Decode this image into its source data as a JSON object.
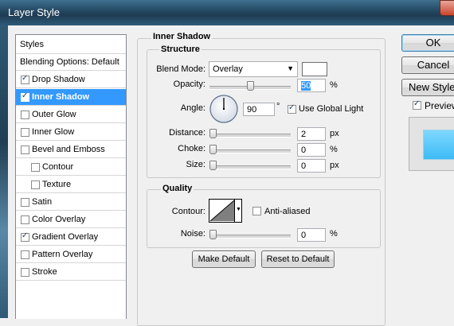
{
  "window": {
    "title": "Layer Style"
  },
  "styles_panel": {
    "header": "Styles",
    "items": [
      {
        "label": "Blending Options: Default",
        "checkbox": false,
        "checked": false,
        "indent": false,
        "selected": false
      },
      {
        "label": "Drop Shadow",
        "checkbox": true,
        "checked": true,
        "indent": false,
        "selected": false
      },
      {
        "label": "Inner Shadow",
        "checkbox": true,
        "checked": true,
        "indent": false,
        "selected": true
      },
      {
        "label": "Outer Glow",
        "checkbox": true,
        "checked": false,
        "indent": false,
        "selected": false
      },
      {
        "label": "Inner Glow",
        "checkbox": true,
        "checked": false,
        "indent": false,
        "selected": false
      },
      {
        "label": "Bevel and Emboss",
        "checkbox": true,
        "checked": false,
        "indent": false,
        "selected": false
      },
      {
        "label": "Contour",
        "checkbox": true,
        "checked": false,
        "indent": true,
        "selected": false
      },
      {
        "label": "Texture",
        "checkbox": true,
        "checked": false,
        "indent": true,
        "selected": false
      },
      {
        "label": "Satin",
        "checkbox": true,
        "checked": false,
        "indent": false,
        "selected": false
      },
      {
        "label": "Color Overlay",
        "checkbox": true,
        "checked": false,
        "indent": false,
        "selected": false
      },
      {
        "label": "Gradient Overlay",
        "checkbox": true,
        "checked": true,
        "indent": false,
        "selected": false
      },
      {
        "label": "Pattern Overlay",
        "checkbox": true,
        "checked": false,
        "indent": false,
        "selected": false
      },
      {
        "label": "Stroke",
        "checkbox": true,
        "checked": false,
        "indent": false,
        "selected": false
      }
    ]
  },
  "inner_shadow": {
    "section_title": "Inner Shadow",
    "structure": {
      "title": "Structure",
      "blend_mode_label": "Blend Mode:",
      "blend_mode_value": "Overlay",
      "blend_color": "#ffffff",
      "opacity_label": "Opacity:",
      "opacity_value": "50",
      "opacity_fraction": 0.5,
      "opacity_unit": "%",
      "angle_label": "Angle:",
      "angle_value": "90",
      "angle_unit": "°",
      "use_global_light_label": "Use Global Light",
      "use_global_light": true,
      "distance_label": "Distance:",
      "distance_value": "2",
      "distance_fraction": 0.0,
      "distance_unit": "px",
      "choke_label": "Choke:",
      "choke_value": "0",
      "choke_fraction": 0.0,
      "choke_unit": "%",
      "size_label": "Size:",
      "size_value": "0",
      "size_fraction": 0.0,
      "size_unit": "px"
    },
    "quality": {
      "title": "Quality",
      "contour_label": "Contour:",
      "anti_aliased_label": "Anti-aliased",
      "anti_aliased": false,
      "noise_label": "Noise:",
      "noise_value": "0",
      "noise_fraction": 0.0,
      "noise_unit": "%"
    },
    "make_default_label": "Make Default",
    "reset_default_label": "Reset to Default"
  },
  "right_panel": {
    "ok_label": "OK",
    "cancel_label": "Cancel",
    "new_style_label": "New Style...",
    "preview_label": "Preview",
    "preview_checked": true,
    "preview_color": "#3dbbf5"
  }
}
